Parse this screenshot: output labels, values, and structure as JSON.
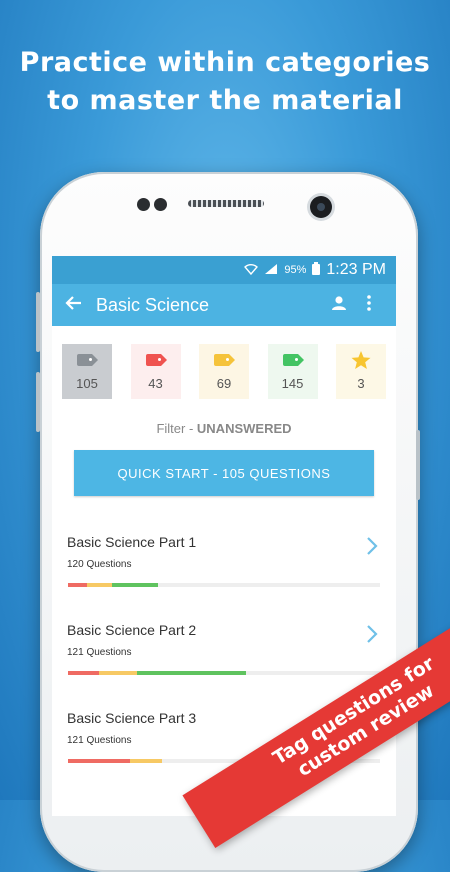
{
  "headline": {
    "line1": "Practice within categories",
    "line2": "to master the material"
  },
  "status_bar": {
    "battery": "95%",
    "time": "1:23 PM"
  },
  "app_bar": {
    "title": "Basic Science",
    "back_icon": "arrow-left-icon",
    "profile_icon": "person-icon",
    "more_icon": "more-vert-icon"
  },
  "tags": [
    {
      "count": "105",
      "icon": "tag-icon",
      "color": "#8a9096",
      "bg": "#c9ccd0",
      "selected": true
    },
    {
      "count": "43",
      "icon": "tag-icon",
      "color": "#ef5350",
      "bg": "#fdeeee",
      "selected": false
    },
    {
      "count": "69",
      "icon": "tag-icon",
      "color": "#f5c33b",
      "bg": "#fdf6e4",
      "selected": false
    },
    {
      "count": "145",
      "icon": "tag-icon",
      "color": "#43c463",
      "bg": "#eef8ef",
      "selected": false
    },
    {
      "count": "3",
      "icon": "star-icon",
      "color": "#f7c531",
      "bg": "#fdf8e6",
      "selected": false
    }
  ],
  "filter": {
    "label": "Filter - ",
    "value": "UNANSWERED"
  },
  "quick_start": "QUICK START - 105 QUESTIONS",
  "sections": [
    {
      "name": "Basic Science Part 1",
      "count": "120 Questions",
      "progress": [
        {
          "color": "#ef6b63",
          "pct": 6
        },
        {
          "color": "#f7c964",
          "pct": 8
        },
        {
          "color": "#5fc35f",
          "pct": 15
        }
      ]
    },
    {
      "name": "Basic Science Part 2",
      "count": "121 Questions",
      "progress": [
        {
          "color": "#ef6b63",
          "pct": 10
        },
        {
          "color": "#f7c964",
          "pct": 12
        },
        {
          "color": "#5fc35f",
          "pct": 35
        }
      ]
    },
    {
      "name": "Basic Science Part 3",
      "count": "121 Questions",
      "progress": [
        {
          "color": "#ef6b63",
          "pct": 20
        },
        {
          "color": "#f7c964",
          "pct": 10
        },
        {
          "color": "#5fc35f",
          "pct": 0
        }
      ]
    }
  ],
  "ribbon": {
    "line1": "Tag questions for",
    "line2": "custom review"
  }
}
